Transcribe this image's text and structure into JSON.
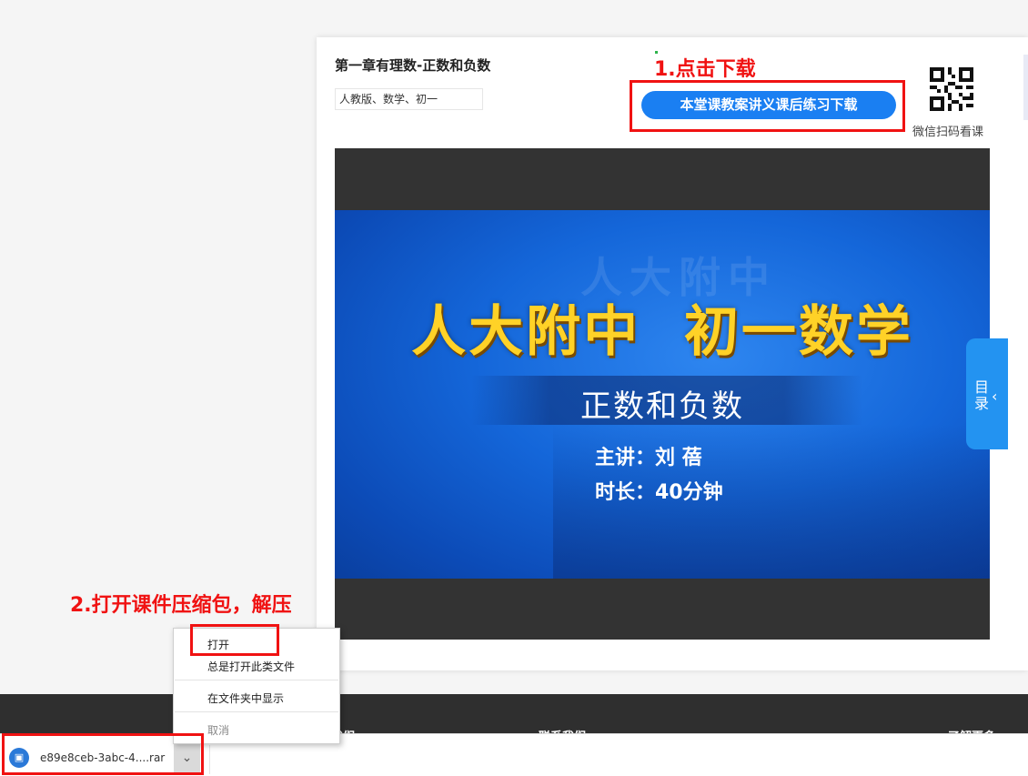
{
  "course": {
    "title": "第一章有理数-正数和负数",
    "tag": "人教版、数学、初一",
    "download_label": "本堂课教案讲义课后练习下载",
    "qr_label": "微信扫码看课"
  },
  "video": {
    "main_title": "人大附中  初一数学",
    "subtitle": "正数和负数",
    "lecturer": "主讲：刘  蓓",
    "duration": "时长：40分钟",
    "watermark": "人大附中",
    "toc_label": "目录",
    "toc_icon": "chevron-left-icon"
  },
  "annotations": {
    "step1": "1.点击下载",
    "step2": "2.打开课件压缩包，解压",
    "color": "#f01212"
  },
  "footer": {
    "items": [
      "关于我们",
      "联系我们",
      "了解更多"
    ]
  },
  "download_bar": {
    "file_name": "e89e8ceb-3abc-4....rar",
    "file_icon": "archive-file-icon",
    "menu_icon": "chevron-down-icon"
  },
  "context_menu": {
    "open": "打开",
    "always_open": "总是打开此类文件",
    "show_in_folder": "在文件夹中显示",
    "cancel": "取消"
  },
  "colors": {
    "accent": "#1a7ff2",
    "toc_tab": "#2393f1",
    "footer": "#2f2f2f",
    "title_gold": "#ffd227"
  }
}
